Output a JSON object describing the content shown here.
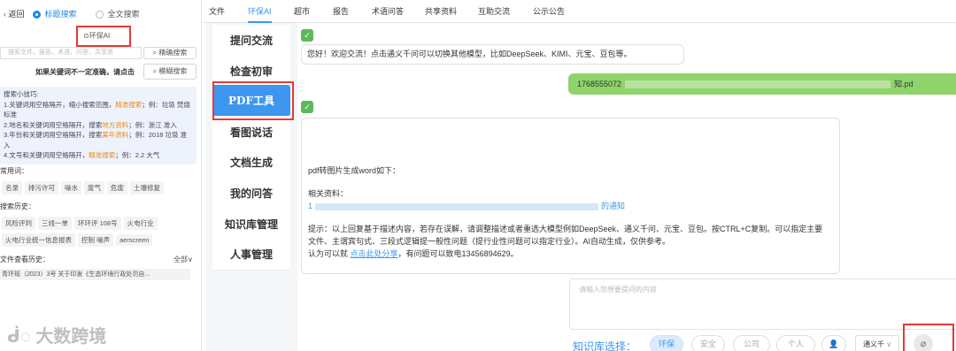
{
  "left": {
    "back_label": "返回",
    "search_modes": [
      "标题搜索",
      "全文搜索"
    ],
    "selected_mode": "标题搜索",
    "category_value": "⊙环保AI",
    "search_placeholder": "搜索文件，报告，术语，问答，共享资",
    "precise_button": "精确搜索",
    "hint_text": "如果关键词不一定准确，请点击",
    "fuzzy_button": "模糊搜索",
    "tips_title": "搜索小技巧:",
    "tips": [
      {
        "pre": "1.关键词用空格隔开，缩小搜索范围，",
        "hl": "精准搜索",
        "post": "；例：垃圾 焚烧 标准"
      },
      {
        "pre": "2.地名和关键词用空格隔开，搜索",
        "hl": "地方资料",
        "post": "；例：浙江 准入"
      },
      {
        "pre": "3.年份和关键词用空格隔开，搜索",
        "hl": "某年资料",
        "post": "；例：2018 垃圾 准入"
      },
      {
        "pre": "4.文号和关键词用空格隔开，",
        "hl": "精准搜索",
        "post": "；例：2.2 大气"
      }
    ],
    "common_label": "常用词：",
    "common_tags": [
      "名录",
      "排污许可",
      "噪水",
      "废气",
      "危废",
      "土壤修复"
    ],
    "history_label": "搜索历史：",
    "history_tags": [
      "风险评判",
      "三线一单",
      "环环评 108号",
      "火电行业",
      "火电行业统一信息报表",
      "控制 噪声",
      "aerscreen"
    ],
    "file_history_label": "文件查看历史：",
    "file_history_all": "全部∨",
    "file_history_item": "青环规（2023）3号 关于印发《生态环境行政处罚自..."
  },
  "tabs": [
    "文件",
    "环保AI",
    "超市",
    "报告",
    "术语问答",
    "共享资料",
    "互助交流",
    "公示公告"
  ],
  "active_tab": "环保AI",
  "menu": [
    "提问交流",
    "检查初审",
    "PDF工具",
    "看图说话",
    "文档生成",
    "我的问答",
    "知识库管理",
    "人事管理"
  ],
  "active_menu": "PDF工具",
  "chat": {
    "greeting": "您好！欢迎交流！点击通义千问可以切换其他模型，比如DeepSeek、KIMI、元宝、豆包等。",
    "user_file_start": "1768555072",
    "user_file_end": "知.pd",
    "reply_intro": "pdf转图片生成word如下：",
    "related_label": "相关资料：",
    "related_link_end": "的通知",
    "hint": "提示：以上回复基于描述内容，若存在误解，请调整描述或者重选大模型例如DeepSeek、通义千问、元宝、豆包。按CTRL+C复制。可以指定主要文件、主谓宾句式、三段式逻辑提一般性问题（提行业性问题可以指定行业）。AI自动生成，仅供参考。",
    "share_pre": "认为可以就",
    "share_link": "点击此处分享",
    "share_post": "，有问题可以致电13456894629。"
  },
  "composer": {
    "placeholder": "请输入您想要提问的内容",
    "kb_label": "知识库选择：",
    "kb_options": [
      "环保",
      "安全",
      "公司",
      "个人"
    ],
    "kb_selected": "环保",
    "model_value": "通义千",
    "watermark": "大数跨境"
  },
  "colors": {
    "accent": "#3d97ef",
    "user_bubble": "#8fd46b",
    "highlight_box": "#e53935",
    "tip_highlight": "#e8891a"
  }
}
